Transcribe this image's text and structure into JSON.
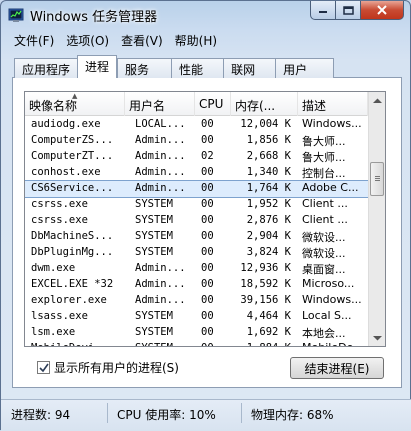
{
  "window": {
    "title": "Windows 任务管理器",
    "caption": {
      "minimize_icon": "minimize-icon",
      "maximize_icon": "maximize-icon",
      "close_icon": "close-icon"
    }
  },
  "menu": [
    "文件(F)",
    "选项(O)",
    "查看(V)",
    "帮助(H)"
  ],
  "tabs": [
    {
      "label": "应用程序",
      "active": false
    },
    {
      "label": "进程",
      "active": true
    },
    {
      "label": "服务",
      "active": false
    },
    {
      "label": "性能",
      "active": false
    },
    {
      "label": "联网",
      "active": false
    },
    {
      "label": "用户",
      "active": false
    }
  ],
  "table": {
    "columns": [
      "映像名称",
      "用户名",
      "CPU",
      "内存(...",
      "描述"
    ],
    "rows": [
      {
        "name": "audiodg.exe",
        "user": "LOCAL...",
        "cpu": "00",
        "mem": "12,004 K",
        "desc": "Windows..."
      },
      {
        "name": "ComputerZS...",
        "user": "Admin...",
        "cpu": "00",
        "mem": "1,856 K",
        "desc": "鲁大师..."
      },
      {
        "name": "ComputerZT...",
        "user": "Admin...",
        "cpu": "02",
        "mem": "2,668 K",
        "desc": "鲁大师..."
      },
      {
        "name": "conhost.exe",
        "user": "Admin...",
        "cpu": "00",
        "mem": "1,340 K",
        "desc": "控制台..."
      },
      {
        "name": "CS6Service...",
        "user": "Admin...",
        "cpu": "00",
        "mem": "1,764 K",
        "desc": "Adobe C..."
      },
      {
        "name": "csrss.exe",
        "user": "SYSTEM",
        "cpu": "00",
        "mem": "1,952 K",
        "desc": "Client ..."
      },
      {
        "name": "csrss.exe",
        "user": "SYSTEM",
        "cpu": "00",
        "mem": "2,876 K",
        "desc": "Client ..."
      },
      {
        "name": "DbMachineS...",
        "user": "SYSTEM",
        "cpu": "00",
        "mem": "2,904 K",
        "desc": "微软设..."
      },
      {
        "name": "DbPluginMg...",
        "user": "SYSTEM",
        "cpu": "00",
        "mem": "3,824 K",
        "desc": "微软设..."
      },
      {
        "name": "dwm.exe",
        "user": "Admin...",
        "cpu": "00",
        "mem": "12,936 K",
        "desc": "桌面窗..."
      },
      {
        "name": "EXCEL.EXE *32",
        "user": "Admin...",
        "cpu": "00",
        "mem": "18,592 K",
        "desc": "Microso..."
      },
      {
        "name": "explorer.exe",
        "user": "Admin...",
        "cpu": "00",
        "mem": "39,156 K",
        "desc": "Windows..."
      },
      {
        "name": "lsass.exe",
        "user": "SYSTEM",
        "cpu": "00",
        "mem": "4,464 K",
        "desc": "Local S..."
      },
      {
        "name": "lsm.exe",
        "user": "SYSTEM",
        "cpu": "00",
        "mem": "1,692 K",
        "desc": "本地会..."
      },
      {
        "name": "MobileDevi...",
        "user": "SYSTEM",
        "cpu": "00",
        "mem": "1,884 K",
        "desc": "MobileDe..."
      }
    ],
    "selected_index": 4
  },
  "show_all_users": {
    "label": "显示所有用户的进程(S)",
    "checked": true
  },
  "end_process_label": "结束进程(E)",
  "status": {
    "processes": "进程数: 94",
    "cpu": "CPU 使用率: 10%",
    "memory": "物理内存: 68%"
  }
}
